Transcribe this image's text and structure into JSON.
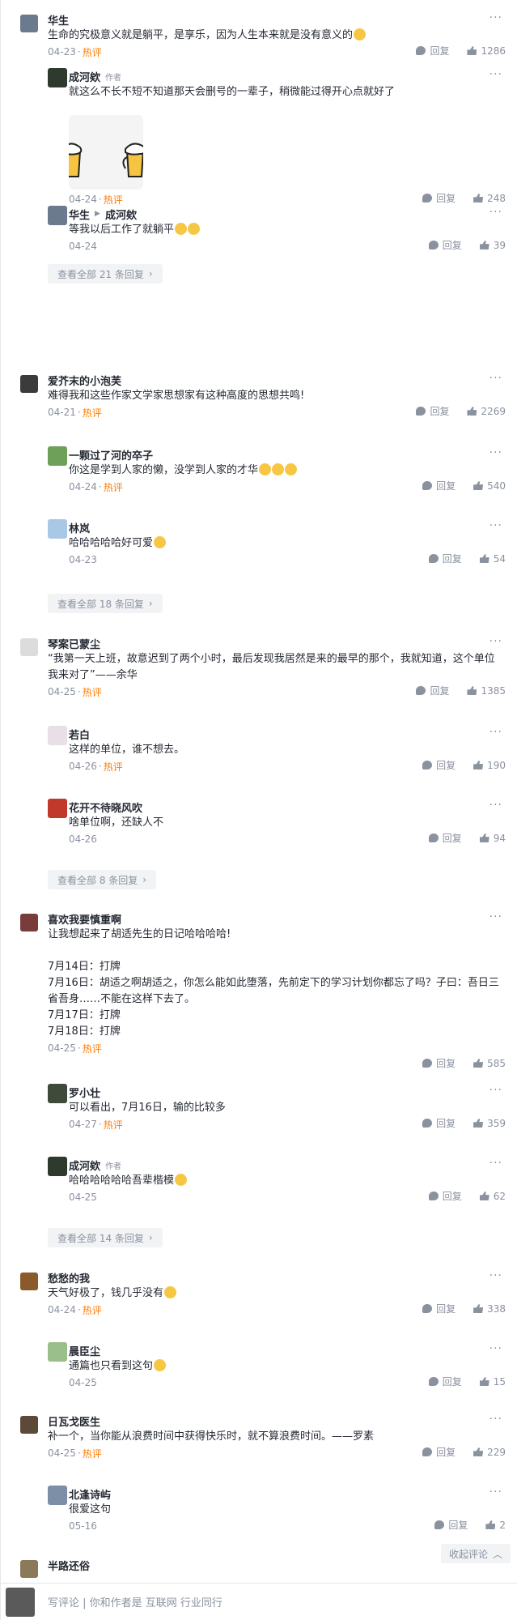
{
  "ui": {
    "reply_label": "回复",
    "hot_label": "热评",
    "author_label": "作者",
    "more_glyph": "···",
    "collapse_label": "收起评论",
    "comment_placeholder": "写评论 | 你和作者是 互联网 行业同行"
  },
  "threads": [
    {
      "name": "华生",
      "text": "生命的究极意义就是躺平，是享乐，因为人生本来就是没有意义的",
      "date": "04-23",
      "hot": true,
      "likes": "1286",
      "view_all": "查看全部 21 条回复",
      "replies": [
        {
          "name": "成河欸",
          "author": true,
          "text": "就这么不长不短不知道那天会删号的一辈子，稍微能过得开心点就好了",
          "date": "04-24",
          "hot": true,
          "likes": "248"
        },
        {
          "name": "华生",
          "reply_to": "成河欸",
          "text": "等我以后工作了就躺平",
          "date": "04-24",
          "hot": false,
          "likes": "39"
        }
      ]
    },
    {
      "name": "爱芥末的小泡芙",
      "text": "难得我和这些作家文学家思想家有这种高度的思想共鸣!",
      "date": "04-21",
      "hot": true,
      "likes": "2269",
      "view_all": "查看全部 18 条回复",
      "replies": [
        {
          "name": "一颗过了河的卒子",
          "text": "你这是学到人家的懒，没学到人家的才华",
          "date": "04-24",
          "hot": true,
          "likes": "540"
        },
        {
          "name": "林岚",
          "text": "哈哈哈哈哈好可爱",
          "date": "04-23",
          "hot": false,
          "likes": "54"
        }
      ]
    },
    {
      "name": "琴案已蒙尘",
      "text": "“我第一天上班，故意迟到了两个小时，最后发现我居然是来的最早的那个，我就知道，这个单位我来对了”——余华",
      "date": "04-25",
      "hot": true,
      "likes": "1385",
      "view_all": "查看全部 8 条回复",
      "replies": [
        {
          "name": "若白",
          "text": "这样的单位，谁不想去。",
          "date": "04-26",
          "hot": true,
          "likes": "190"
        },
        {
          "name": "花开不待晓风吹",
          "text": "啥单位啊，还缺人不",
          "date": "04-26",
          "hot": false,
          "likes": "94"
        }
      ]
    },
    {
      "name": "喜欢我要慎重啊",
      "text": "让我想起来了胡适先生的日记哈哈哈哈!\n\n7月14日：打牌\n7月16日：胡适之啊胡适之，你怎么能如此堕落，先前定下的学习计划你都忘了吗？子曰：吾日三省吾身……不能在这样下去了。\n7月17日：打牌\n7月18日：打牌",
      "date": "04-25",
      "hot": true,
      "likes": "585",
      "view_all": "查看全部 14 条回复",
      "replies": [
        {
          "name": "罗小壮",
          "text": "可以看出，7月16日，输的比较多",
          "date": "04-27",
          "hot": true,
          "likes": "359"
        },
        {
          "name": "成河欸",
          "author": true,
          "text": "哈哈哈哈哈哈吾辈楷模",
          "date": "04-25",
          "hot": false,
          "likes": "62"
        }
      ]
    },
    {
      "name": "愁愁的我",
      "text": "天气好极了，钱几乎没有",
      "date": "04-24",
      "hot": true,
      "likes": "338",
      "replies": [
        {
          "name": "晨臣尘",
          "text": "通篇也只看到这句",
          "date": "04-25",
          "hot": false,
          "likes": "15"
        }
      ]
    },
    {
      "name": "日瓦戈医生",
      "text": "补一个，当你能从浪费时间中获得快乐时，就不算浪费时间。——罗素",
      "date": "04-25",
      "hot": true,
      "likes": "229",
      "replies": [
        {
          "name": "北逢诗屿",
          "text": "很爱这句",
          "date": "05-16",
          "hot": false,
          "likes": "2"
        }
      ]
    },
    {
      "name": "半路还俗"
    }
  ]
}
